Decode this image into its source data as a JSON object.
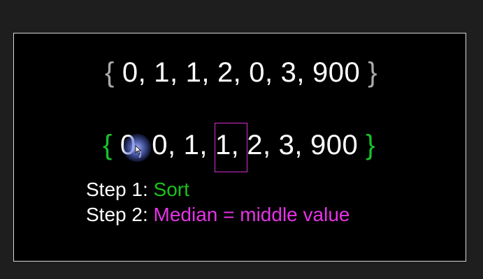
{
  "colors": {
    "background": "#000000",
    "frame_border": "#d8d8d8",
    "text": "#ffffff",
    "brace_original": "#a9a9a9",
    "brace_sorted": "#17c12a",
    "median_box": "#d42fd4",
    "step1_value": "#18c21c",
    "step2_value": "#e533e5"
  },
  "original_set": {
    "open_brace": "{",
    "values": [
      "0,",
      "1,",
      "1,",
      "2,",
      "0,",
      "3,",
      "900"
    ],
    "close_brace": "}"
  },
  "sorted_set": {
    "open_brace": "{",
    "values": [
      "0,",
      "0,",
      "1,",
      "1,",
      "2,",
      "3,",
      "900"
    ],
    "close_brace": "}"
  },
  "steps": [
    {
      "label": "Step 1:",
      "value": "Sort"
    },
    {
      "label": "Step 2:",
      "value": "Median = middle value"
    }
  ],
  "icons": {
    "cursor": "pointer-cursor-icon"
  }
}
